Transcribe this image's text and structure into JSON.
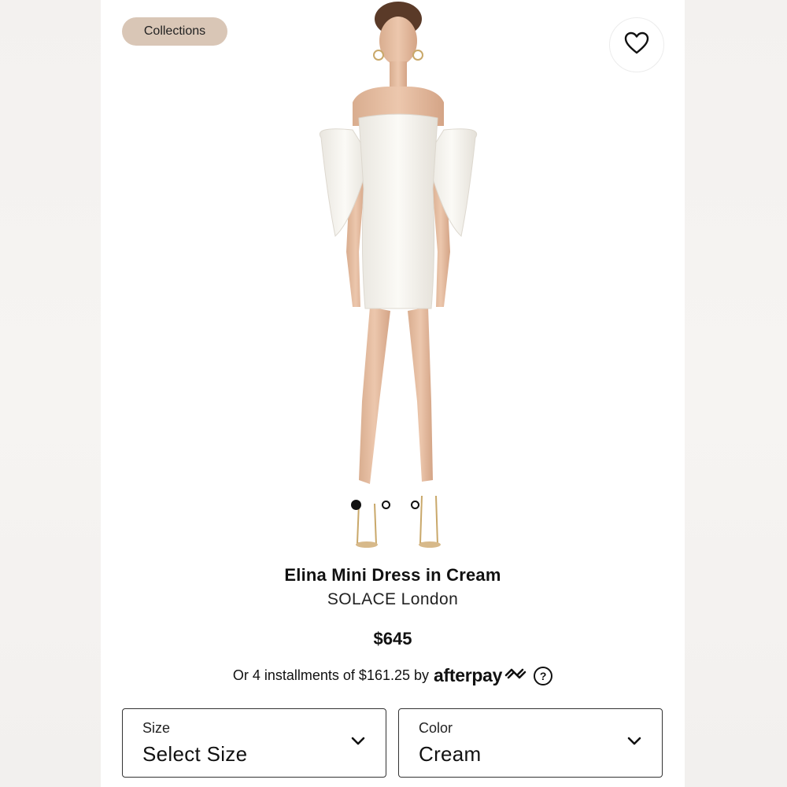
{
  "header": {
    "collections_label": "Collections"
  },
  "gallery": {
    "image_count": 3,
    "active_index": 0
  },
  "product": {
    "title": "Elina Mini Dress in Cream",
    "brand": "SOLACE London",
    "price": "$645",
    "installments_text": "Or 4 installments of $161.25 by",
    "afterpay_label": "afterpay",
    "help_label": "?"
  },
  "options": {
    "size": {
      "label": "Size",
      "value": "Select Size"
    },
    "color": {
      "label": "Color",
      "value": "Cream"
    }
  },
  "icons": {
    "wishlist": "heart-icon",
    "dropdown": "chevron-down-icon",
    "afterpay": "afterpay-logo-icon",
    "help": "question-icon"
  },
  "colors": {
    "collections_chip": "#d9c6b6",
    "text": "#111111",
    "background": "#ffffff"
  }
}
